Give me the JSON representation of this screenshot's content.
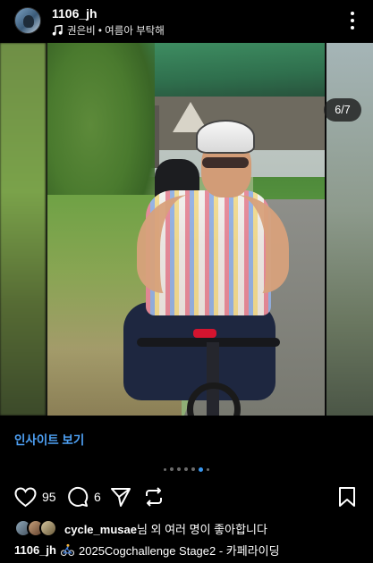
{
  "header": {
    "username": "1106_jh",
    "music": "권은비 • 여름아 부탁해",
    "avatar_icon": "profile-avatar",
    "more_icon": "more-vertical-icon"
  },
  "carousel": {
    "page_indicator": "6/7",
    "current_index": 6,
    "total": 7,
    "sound_icon": "speaker-icon"
  },
  "insights": {
    "label": "인사이트 보기",
    "color": "#4ea1f5"
  },
  "actions": {
    "like_count": "95",
    "comment_count": "6",
    "icons": [
      "heart-icon",
      "comment-icon",
      "send-icon",
      "repost-icon",
      "bookmark-icon"
    ]
  },
  "likes": {
    "user": "cycle_musae",
    "suffix": "님 외 여러 명이 좋아합니다"
  },
  "caption": {
    "user": "1106_jh",
    "text": "2025Cogchallenge Stage2 - 카페라이딩"
  },
  "colors": {
    "background": "#000000",
    "accent": "#3897f0",
    "link": "#4ea1f5"
  }
}
